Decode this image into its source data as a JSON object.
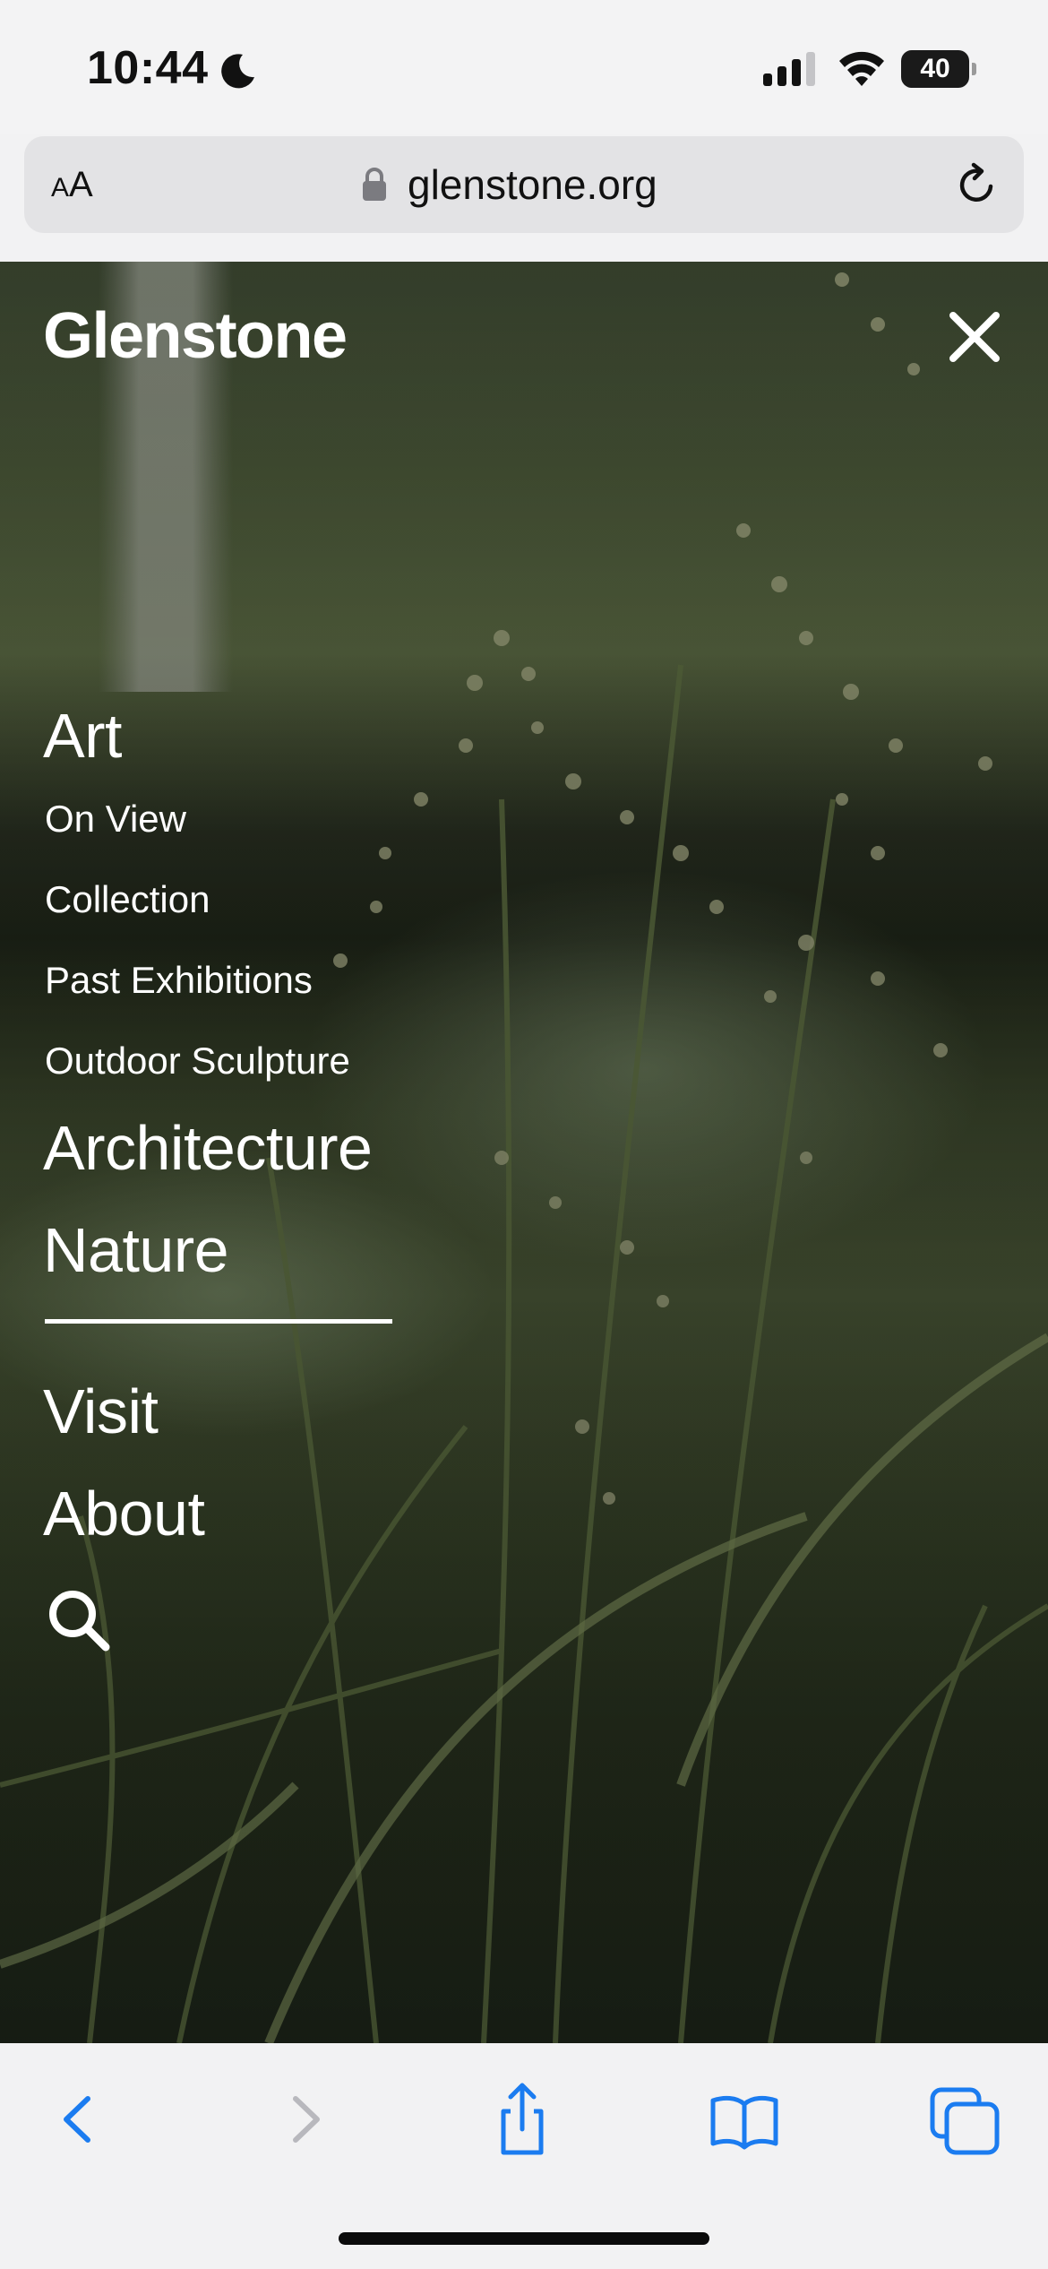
{
  "status_bar": {
    "time": "10:44",
    "battery": "40",
    "icons": [
      "moon-icon",
      "signal-icon",
      "wifi-icon",
      "battery-icon"
    ]
  },
  "browser": {
    "text_size_button": {
      "small": "A",
      "large": "A"
    },
    "url": "glenstone.org",
    "icons": [
      "lock-icon",
      "reload-icon"
    ]
  },
  "site": {
    "logo": "Glenstone",
    "close_icon": "close-icon"
  },
  "nav": {
    "art": "Art",
    "art_items": [
      "On View",
      "Collection",
      "Past Exhibitions",
      "Outdoor Sculpture"
    ],
    "architecture": "Architecture",
    "nature": "Nature",
    "visit": "Visit",
    "about": "About",
    "search_icon": "search-icon"
  },
  "toolbar": {
    "icons": [
      "back-icon",
      "forward-icon",
      "share-icon",
      "bookmarks-icon",
      "tabs-icon"
    ],
    "accent_color": "#1b7cf0",
    "disabled_color": "#b8b8bd"
  }
}
